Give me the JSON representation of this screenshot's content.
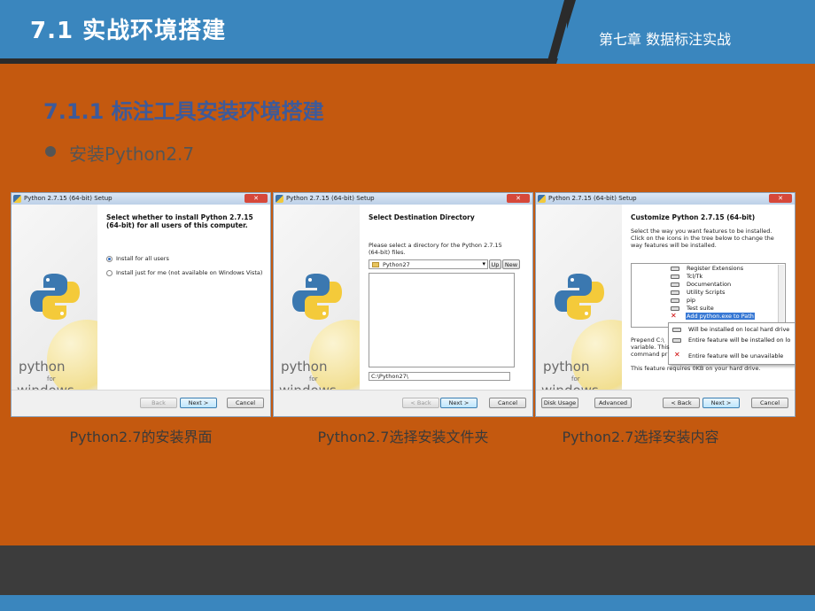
{
  "header": {
    "title": "7.1 实战环境搭建",
    "chapter": "第七章  数据标注实战"
  },
  "section": {
    "title": "7.1.1 标注工具安装环境搭建",
    "bullet": "安装Python2.7"
  },
  "windows": [
    {
      "titlebar": "Python 2.7.15 (64-bit) Setup",
      "heading": "Select whether to install Python 2.7.15 (64-bit) for all users of this computer.",
      "options": [
        "Install for all users",
        "Install just for me (not available on Windows Vista)"
      ],
      "buttons": {
        "back": "Back",
        "next": "Next >",
        "cancel": "Cancel"
      },
      "caption": "Python2.7的安装界面"
    },
    {
      "titlebar": "Python 2.7.15 (64-bit) Setup",
      "heading": "Select Destination Directory",
      "prompt": "Please select a directory for the Python 2.7.15 (64-bit) files.",
      "folder": "Python27",
      "up": "Up",
      "new": "New",
      "path": "C:\\Python27\\",
      "buttons": {
        "back": "< Back",
        "next": "Next >",
        "cancel": "Cancel"
      },
      "caption": "Python2.7选择安装文件夹"
    },
    {
      "titlebar": "Python 2.7.15 (64-bit) Setup",
      "heading": "Customize Python 2.7.15 (64-bit)",
      "prompt": "Select the way you want features to be installed. Click on the icons in the tree below to change the way features will be installed.",
      "tree": [
        "Register Extensions",
        "Tcl/Tk",
        "Documentation",
        "Utility Scripts",
        "pip",
        "Test suite",
        "Add python.exe to Path"
      ],
      "menu": [
        "Will be installed on local hard drive",
        "Entire feature will be installed on lo",
        "Entire feature will be unavailable"
      ],
      "desc": [
        "Prepend C:\\",
        "variable. This",
        "command pr"
      ],
      "footer_text": "This feature requires 0KB on your hard drive.",
      "buttons": {
        "disk": "Disk Usage",
        "advanced": "Advanced",
        "back": "< Back",
        "next": "Next >",
        "cancel": "Cancel"
      },
      "caption": "Python2.7选择安装内容"
    }
  ],
  "side": {
    "python": "python",
    "for": "for",
    "windows": "windows"
  }
}
